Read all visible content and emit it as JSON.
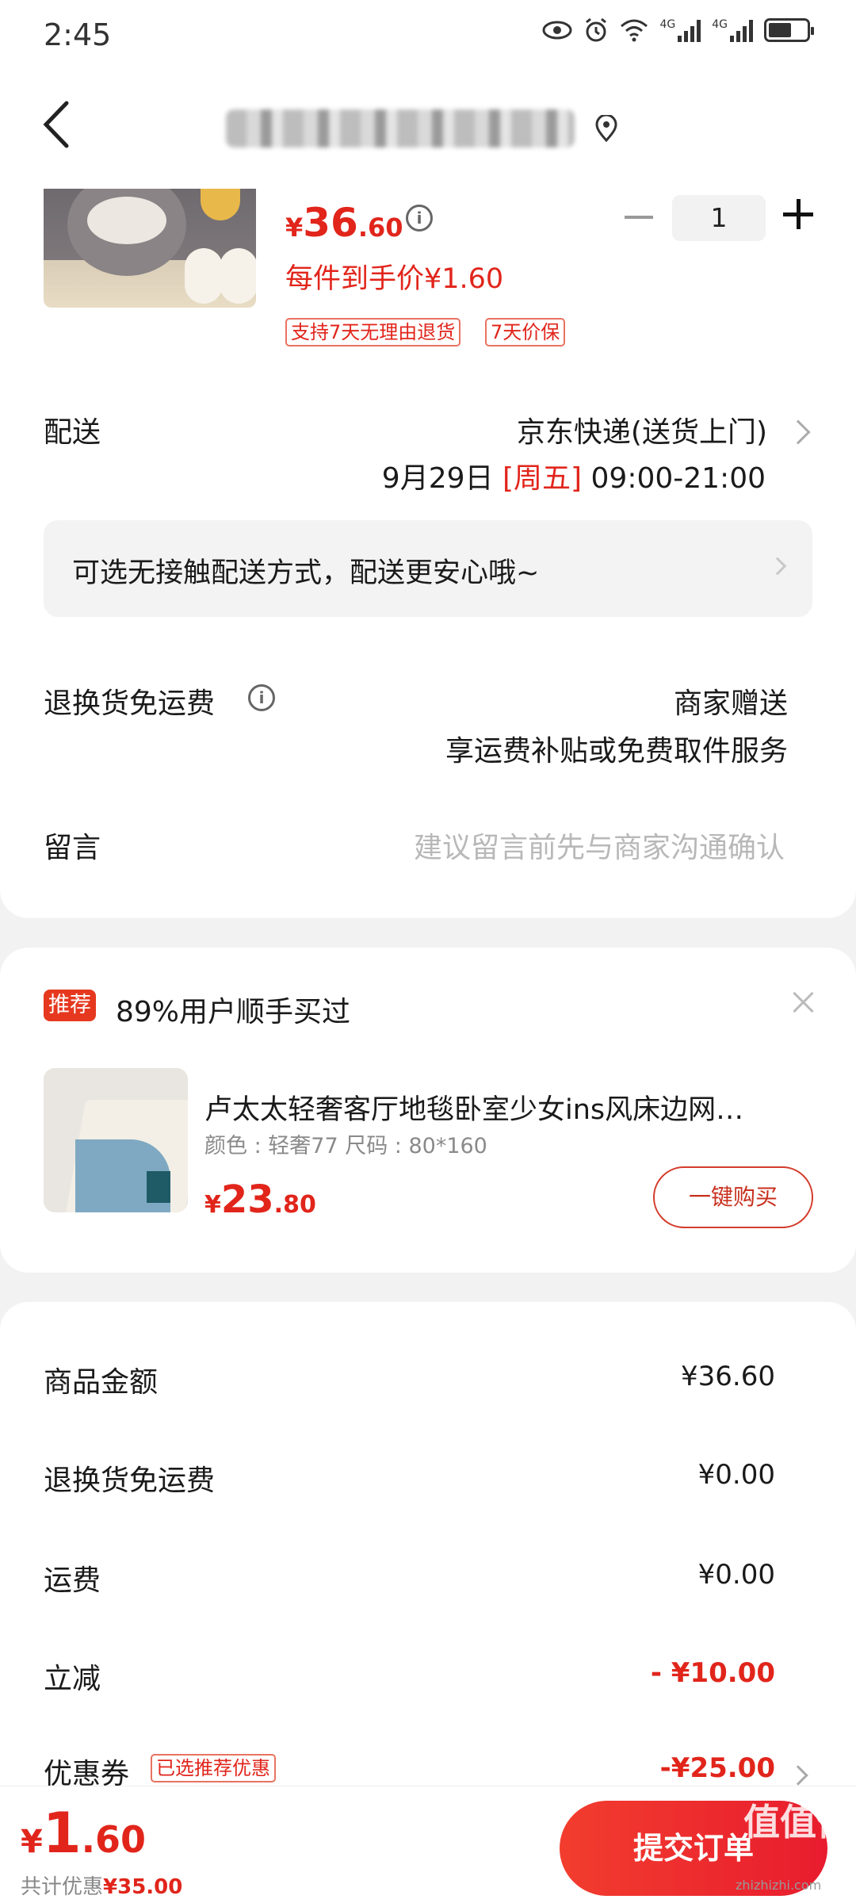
{
  "status_bar": {
    "time": "2:45",
    "network_labels": [
      "4G",
      "4G"
    ]
  },
  "header": {
    "address": ""
  },
  "product": {
    "currency": "¥",
    "price_int": "36",
    "price_dec": ".60",
    "unit_price": "每件到手价¥1.60",
    "tags": [
      "支持7天无理由退货",
      "7天价保"
    ],
    "quantity": "1"
  },
  "delivery": {
    "label": "配送",
    "method": "京东快递(送货上门)",
    "date": "9月29日",
    "weekday": "[周五]",
    "time": "09:00-21:00"
  },
  "notice": {
    "text": "可选无接触配送方式，配送更安心哦~"
  },
  "return_shipping": {
    "label": "退换货免运费",
    "value_line1": "商家赠送",
    "value_line2": "享运费补贴或免费取件服务"
  },
  "message": {
    "label": "留言",
    "placeholder": "建议留言前先与商家沟通确认"
  },
  "recommendation": {
    "badge": "推荐",
    "text": "89%用户顺手买过",
    "title": "卢太太轻奢客厅地毯卧室少女ins风床边网…",
    "spec": "颜色 : 轻奢77    尺码 : 80*160",
    "currency": "¥",
    "price_int": "23",
    "price_dec": ".80",
    "button": "一键购买"
  },
  "summary": {
    "rows": [
      {
        "label": "商品金额",
        "value": "¥36.60"
      },
      {
        "label": "退换货免运费",
        "value": "¥0.00"
      },
      {
        "label": "运费",
        "value": "¥0.00"
      },
      {
        "label": "立减",
        "value": "- ¥10.00"
      },
      {
        "label": "优惠券",
        "value": "-¥25.00"
      }
    ],
    "coupon_tag": "已选推荐优惠"
  },
  "bottom": {
    "currency": "¥",
    "total_int": "1",
    "total_dec": ".60",
    "saved_label": "共计优惠",
    "saved_value": "¥35.00",
    "submit": "提交订单",
    "watermark": "值值值",
    "watermark_sub": "zhizhizhi.com"
  },
  "colors": {
    "accent": "#e1251b",
    "button_start": "#f23d2e",
    "button_end": "#e81c2e"
  }
}
